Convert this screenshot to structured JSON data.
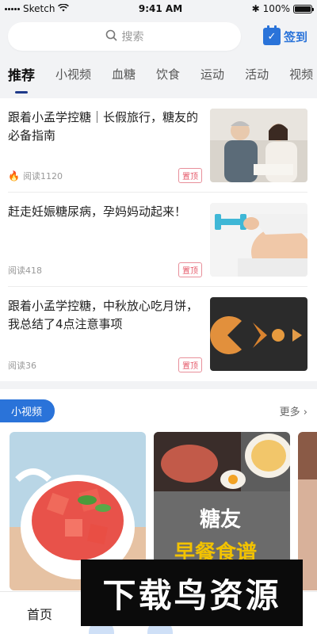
{
  "status": {
    "carrier": "Sketch",
    "time": "9:41 AM",
    "battery": "100%",
    "battery_level": 1.0
  },
  "search": {
    "placeholder": "搜索",
    "signin_label": "签到"
  },
  "tabs": [
    {
      "label": "推荐",
      "active": true
    },
    {
      "label": "小视频"
    },
    {
      "label": "血糖"
    },
    {
      "label": "饮食"
    },
    {
      "label": "运动"
    },
    {
      "label": "活动"
    },
    {
      "label": "视频"
    }
  ],
  "articles": [
    {
      "title": "跟着小孟学控糖｜长假旅行，糖友的必备指南",
      "reads": "阅读1120",
      "pin": "置顶",
      "hot": true
    },
    {
      "title": "赶走妊娠糖尿病，孕妈妈动起来！",
      "reads": "阅读418",
      "pin": "置顶"
    },
    {
      "title": "跟着小孟学控糖，中秋放心吃月饼，我总结了4点注意事项",
      "reads": "阅读36",
      "pin": "置顶"
    }
  ],
  "video_section": {
    "badge": "小视频",
    "more": "更多",
    "card2_text_line1": "糖友",
    "card2_text_line2": "早餐食谱"
  },
  "bottom_nav": {
    "home": "首页"
  },
  "watermark": "下载鸟资源",
  "colors": {
    "accent": "#2a73d9",
    "pin": "#e55a6a",
    "tab_indicator": "#1f3a8a"
  }
}
